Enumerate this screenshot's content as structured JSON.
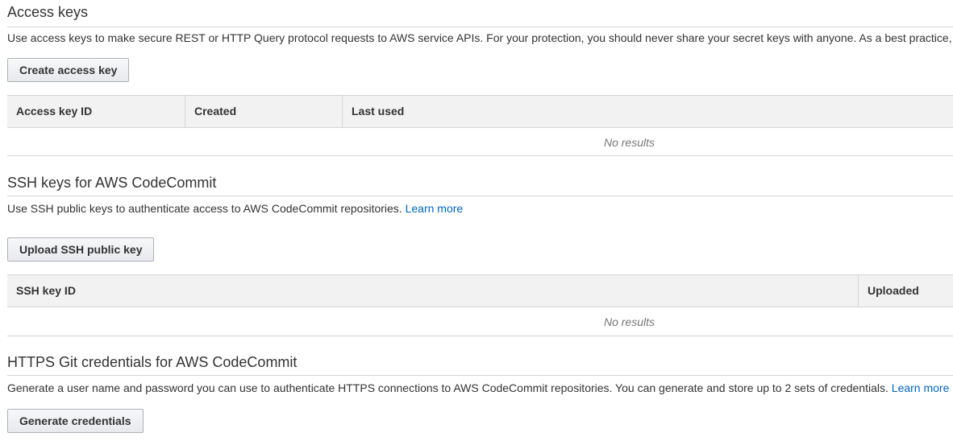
{
  "access_keys": {
    "title": "Access keys",
    "description": "Use access keys to make secure REST or HTTP Query protocol requests to AWS service APIs. For your protection, you should never share your secret keys with anyone. As a best practice,",
    "create_button": "Create access key",
    "columns": [
      "Access key ID",
      "Created",
      "Last used"
    ],
    "empty_text": "No results"
  },
  "ssh_keys": {
    "title": "SSH keys for AWS CodeCommit",
    "description": "Use SSH public keys to authenticate access to AWS CodeCommit repositories.",
    "learn_more": "Learn more",
    "upload_button": "Upload SSH public key",
    "columns": [
      "SSH key ID",
      "Uploaded"
    ],
    "empty_text": "No results"
  },
  "https_git": {
    "title": "HTTPS Git credentials for AWS CodeCommit",
    "description": "Generate a user name and password you can use to authenticate HTTPS connections to AWS CodeCommit repositories. You can generate and store up to 2 sets of credentials.",
    "learn_more": "Learn more",
    "generate_button": "Generate credentials"
  },
  "colors": {
    "link": "#0066c0",
    "header_bg": "#f2f2f2",
    "border": "#d5d5d5"
  }
}
